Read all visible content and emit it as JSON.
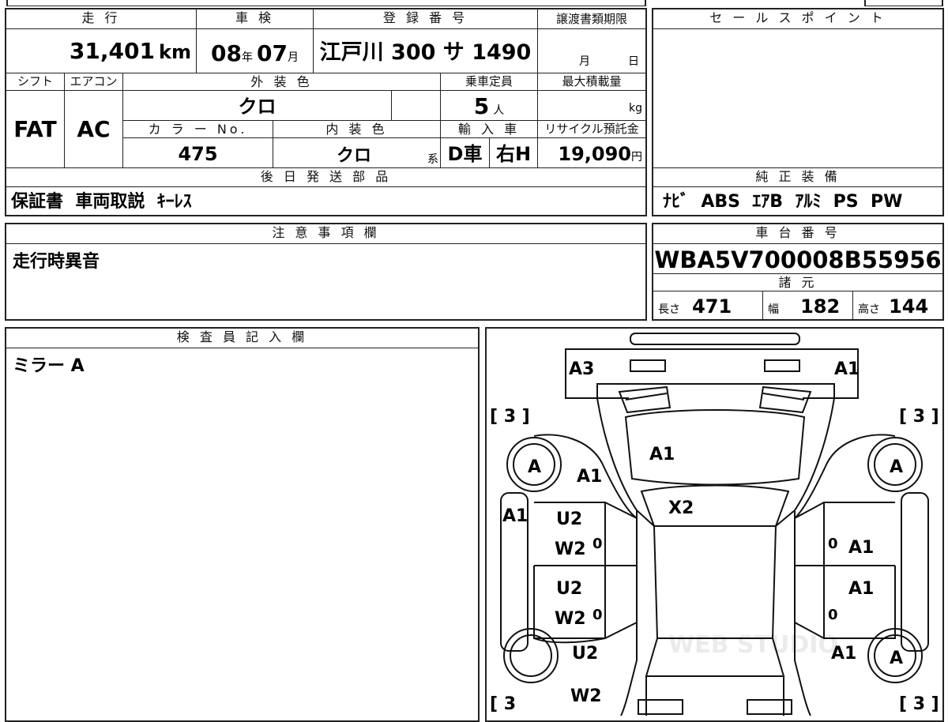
{
  "table": {
    "mileage_header": "走 行",
    "mileage_value": "31,401",
    "mileage_unit": "km",
    "shaken_header": "車 検",
    "shaken_year": "08",
    "shaken_year_unit": "年",
    "shaken_month": "07",
    "shaken_month_unit": "月",
    "plate_header": "登 録 番 号",
    "plate_value": "江戸川 300 サ 1490",
    "transfer_header": "譲渡書類期限",
    "transfer_month_unit": "月",
    "transfer_day_unit": "日",
    "shift_header": "シフト",
    "shift_value": "FAT",
    "ac_header": "エアコン",
    "ac_value": "AC",
    "exterior_color_header": "外 装 色",
    "exterior_color_value": "クロ",
    "capacity_header": "乗車定員",
    "capacity_value": "5",
    "capacity_unit": "人",
    "max_load_header": "最大積載量",
    "max_load_unit": "kg",
    "color_no_header": "カ ラ ー No.",
    "color_no_value": "475",
    "interior_color_header": "内 装 色",
    "interior_color_value": "クロ",
    "interior_color_suffix": "系",
    "import_header": "輸 入 車",
    "import_value": "D車",
    "handle_value": "右H",
    "recycle_header": "リサイクル預託金",
    "recycle_value": "19,090",
    "recycle_unit": "円",
    "later_parts_header": "後 日 発 送 部 品",
    "later_parts_value": "保証書  車両取説  ｷｰﾚｽ",
    "notes_header": "注 意 事 項 欄",
    "notes_value": "走行時異音"
  },
  "right": {
    "sales_point_header": "セ ー ル ス ポ イ ン ト",
    "equipment_header": "純 正 装 備",
    "equipment_value": "ﾅﾋﾞ  ABS  ｴｱB  ｱﾙﾐ  PS  PW",
    "chassis_header": "車 台 番 号",
    "chassis_value": "WBA5V700008B55956",
    "specs_header": "諸 元",
    "length_label": "長さ",
    "length_value": "471",
    "width_label": "幅",
    "width_value": "182",
    "height_label": "高さ",
    "height_value": "144"
  },
  "inspector": {
    "header": "検 査 員 記 入 欄",
    "note": "ミラー A"
  },
  "diagram": {
    "front_left_mark": "A3",
    "front_right_mark": "A1",
    "tire_fl": "[ 3 ]",
    "tire_fr": "[ 3 ]",
    "tire_rl": "[ 3",
    "tire_rr": "[ 3 ]",
    "hood": "A1",
    "left_front_wheel": "A",
    "left_front_fender": "A1",
    "right_front_wheel": "A",
    "windshield": "X2",
    "left_mirror": "A1",
    "left_front_door_1": "U2",
    "left_front_door_2": "W2",
    "left_rear_door_1": "U2",
    "left_rear_door_2": "W2",
    "left_rear_fender_1": "U2",
    "left_rear_fender_2": "W2",
    "right_front_door": "A1",
    "right_rear_door": "A1",
    "right_rear_fender": "A1",
    "right_rear_wheel": "A",
    "zero": "0",
    "watermark": "WEB STUDIO"
  }
}
